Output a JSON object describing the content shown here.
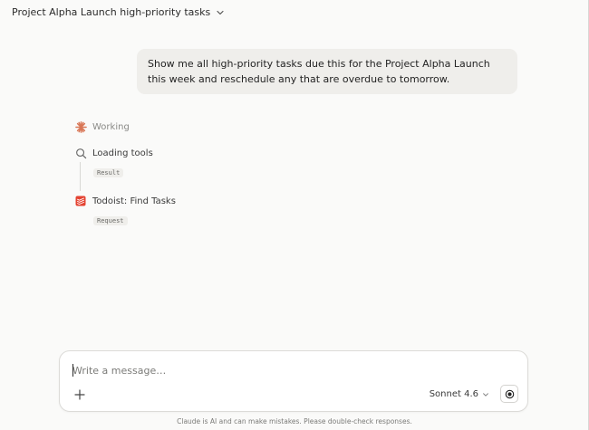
{
  "header": {
    "title": "Project Alpha Launch high-priority tasks"
  },
  "conversation": {
    "user_message": "Show me all high-priority tasks due this for the Project Alpha Launch this week and reschedule any that are overdue to tomorrow.",
    "steps": [
      {
        "label": "Working",
        "icon": "sparkle-icon"
      },
      {
        "label": "Loading tools",
        "icon": "search-icon",
        "tag": "Result"
      },
      {
        "label": "Todoist: Find Tasks",
        "icon": "todoist-icon",
        "tag": "Request"
      }
    ]
  },
  "composer": {
    "placeholder": "Write a message…",
    "model": "Sonnet 4.6"
  },
  "footer": {
    "disclaimer": "Claude is AI and can make mistakes. Please double-check responses."
  },
  "colors": {
    "accent": "#d97757",
    "todoist": "#e44332",
    "background": "#fafaf9",
    "bubble": "#efeeeb"
  }
}
